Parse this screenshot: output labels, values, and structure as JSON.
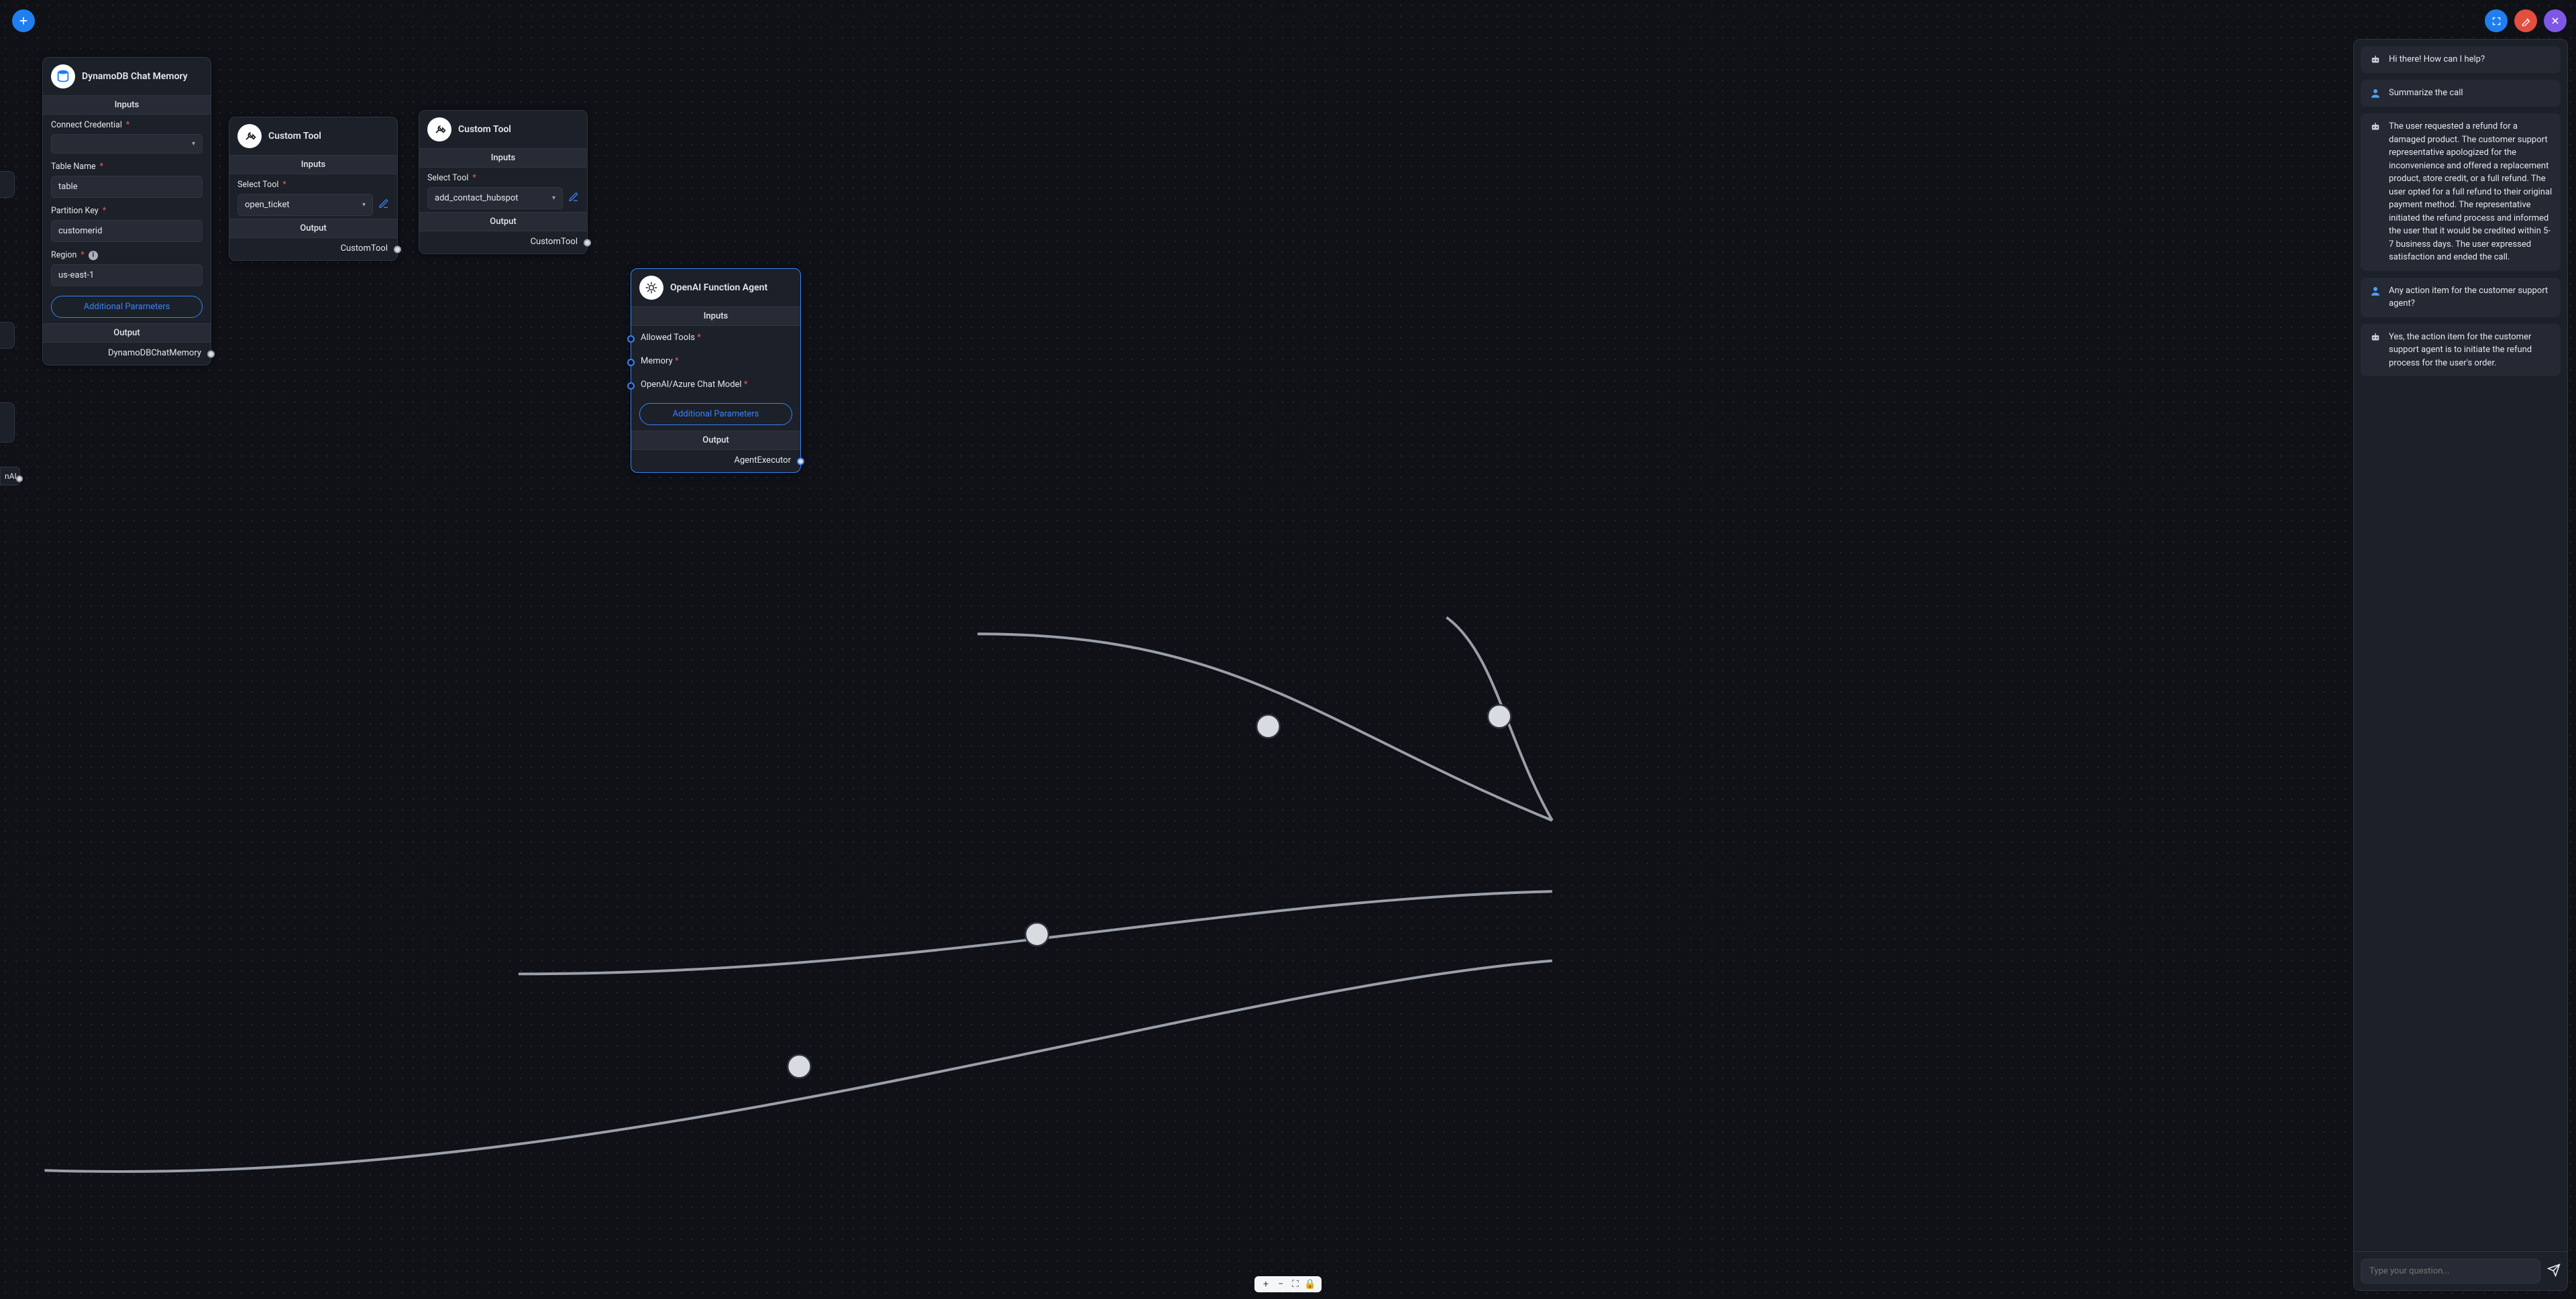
{
  "toolbar": {
    "add_button_name": "add-node-button",
    "expand_button_name": "expand-button",
    "clear_button_name": "clear-button",
    "close_button_name": "close-button"
  },
  "nodes": {
    "dynamo": {
      "title": "DynamoDB Chat Memory",
      "inputs_label": "Inputs",
      "output_label": "Output",
      "output_port": "DynamoDBChatMemory",
      "connect_cred_label": "Connect Credential",
      "table_label": "Table Name",
      "table_value": "table",
      "partition_label": "Partition Key",
      "partition_value": "customerid",
      "region_label": "Region",
      "region_value": "us-east-1",
      "additional_params": "Additional Parameters"
    },
    "tool1": {
      "title": "Custom Tool",
      "inputs_label": "Inputs",
      "output_label": "Output",
      "select_tool_label": "Select Tool",
      "select_tool_value": "open_ticket",
      "output_port": "CustomTool"
    },
    "tool2": {
      "title": "Custom Tool",
      "inputs_label": "Inputs",
      "output_label": "Output",
      "select_tool_label": "Select Tool",
      "select_tool_value": "add_contact_hubspot",
      "output_port": "CustomTool"
    },
    "agent": {
      "title": "OpenAI Function Agent",
      "inputs_label": "Inputs",
      "output_label": "Output",
      "allowed_tools": "Allowed Tools",
      "memory": "Memory",
      "chat_model": "OpenAI/Azure Chat Model",
      "additional_params": "Additional Parameters",
      "output_port": "AgentExecutor"
    },
    "offscreen_output": "nAI"
  },
  "chat": {
    "input_placeholder": "Type your question...",
    "messages": [
      {
        "role": "bot",
        "text": "Hi there! How can I help?"
      },
      {
        "role": "user",
        "text": "Summarize the call"
      },
      {
        "role": "bot",
        "text": "The user requested a refund for a damaged product. The customer support representative apologized for the inconvenience and offered a replacement product, store credit, or a full refund. The user opted for a full refund to their original payment method. The representative initiated the refund process and informed the user that it would be credited within 5-7 business days. The user expressed satisfaction and ended the call."
      },
      {
        "role": "user",
        "text": "Any action item for the customer support agent?"
      },
      {
        "role": "bot",
        "text": "Yes, the action item for the customer support agent is to initiate the refund process for the user's order."
      }
    ]
  },
  "zoom": {
    "in": "+",
    "out": "−",
    "fit": "⛶",
    "lock": "🔒"
  }
}
